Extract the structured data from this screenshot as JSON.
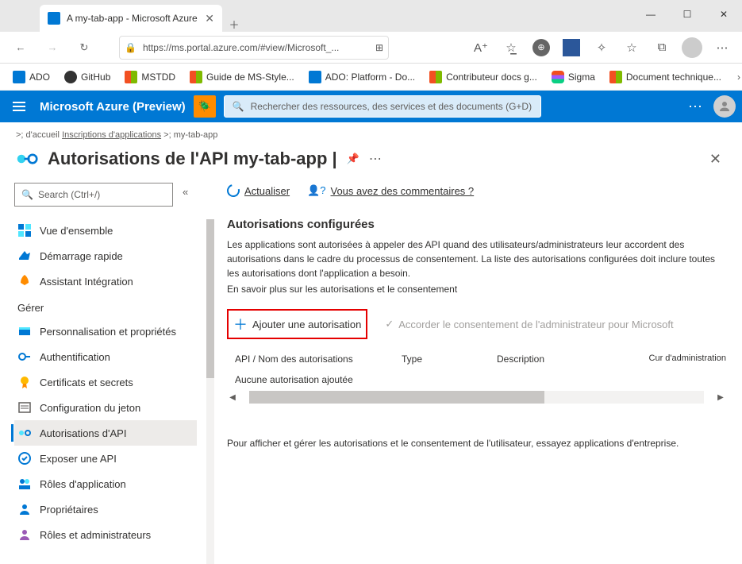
{
  "browser": {
    "tab_title": "A my-tab-app - Microsoft Azure",
    "url": "https://ms.portal.azure.com/#view/Microsoft_...",
    "bookmarks": [
      {
        "label": "ADO",
        "icon": "ado"
      },
      {
        "label": "GitHub",
        "icon": "gh"
      },
      {
        "label": "MSTDD",
        "icon": "ms"
      },
      {
        "label": "Guide de MS-Style...",
        "icon": "ms"
      },
      {
        "label": "ADO: Platform - Do...",
        "icon": "ado"
      },
      {
        "label": "Contributeur docs g...",
        "icon": "ms"
      },
      {
        "label": "Sigma",
        "icon": "figma"
      },
      {
        "label": "Document technique...",
        "icon": "ms"
      }
    ]
  },
  "azure_header": {
    "brand": "Microsoft Azure (Preview)",
    "search_placeholder": "Rechercher des ressources, des services et des documents (G+D)"
  },
  "breadcrumb": {
    "home": ">; d'accueil",
    "link": "Inscriptions d'applications",
    "sep": ">;",
    "current": "my-tab-app"
  },
  "blade": {
    "title": "Autorisations de l'API my-tab-app |"
  },
  "sidebar": {
    "search_placeholder": "Search (Ctrl+/)",
    "collapse": "«",
    "items": [
      {
        "label": "Vue d'ensemble",
        "icon": "overview"
      },
      {
        "label": "Démarrage rapide",
        "icon": "quickstart"
      },
      {
        "label": "Assistant Intégration",
        "icon": "integration"
      }
    ],
    "section_manage": "Gérer",
    "manage_items": [
      {
        "label": "Personnalisation et propriétés",
        "icon": "branding"
      },
      {
        "label": "Authentification",
        "icon": "auth"
      },
      {
        "label": "Certificats et secrets",
        "icon": "certs"
      },
      {
        "label": "Configuration du jeton",
        "icon": "token"
      },
      {
        "label": "Autorisations d'API",
        "icon": "apiperm",
        "selected": true
      },
      {
        "label": "Exposer une API",
        "icon": "expose"
      },
      {
        "label": "Rôles d'application",
        "icon": "roles"
      },
      {
        "label": "Propriétaires",
        "icon": "owners"
      },
      {
        "label": "Rôles et administrateurs",
        "icon": "admins"
      }
    ]
  },
  "commands": {
    "refresh": "Actualiser",
    "feedback": "Vous avez des commentaires ?"
  },
  "section": {
    "title": "Autorisations configurées",
    "desc": "Les applications sont autorisées à appeler des API quand des utilisateurs/administrateurs leur accordent des autorisations dans le cadre du processus de consentement. La liste des autorisations configurées doit inclure toutes les autorisations dont l'application a besoin.",
    "learn_more": "En savoir plus sur les autorisations et le consentement"
  },
  "actions": {
    "add_permission": "Ajouter une autorisation",
    "grant_consent": "Accorder le consentement de l'administrateur pour Microsoft"
  },
  "table": {
    "col_api": "API / Nom des autorisations",
    "col_type": "Type",
    "col_desc": "Description",
    "col_admin": "Cur d'administration",
    "empty": "Aucune autorisation ajoutée"
  },
  "footer": "Pour afficher et gérer les autorisations et le consentement de l'utilisateur, essayez applications d'entreprise."
}
